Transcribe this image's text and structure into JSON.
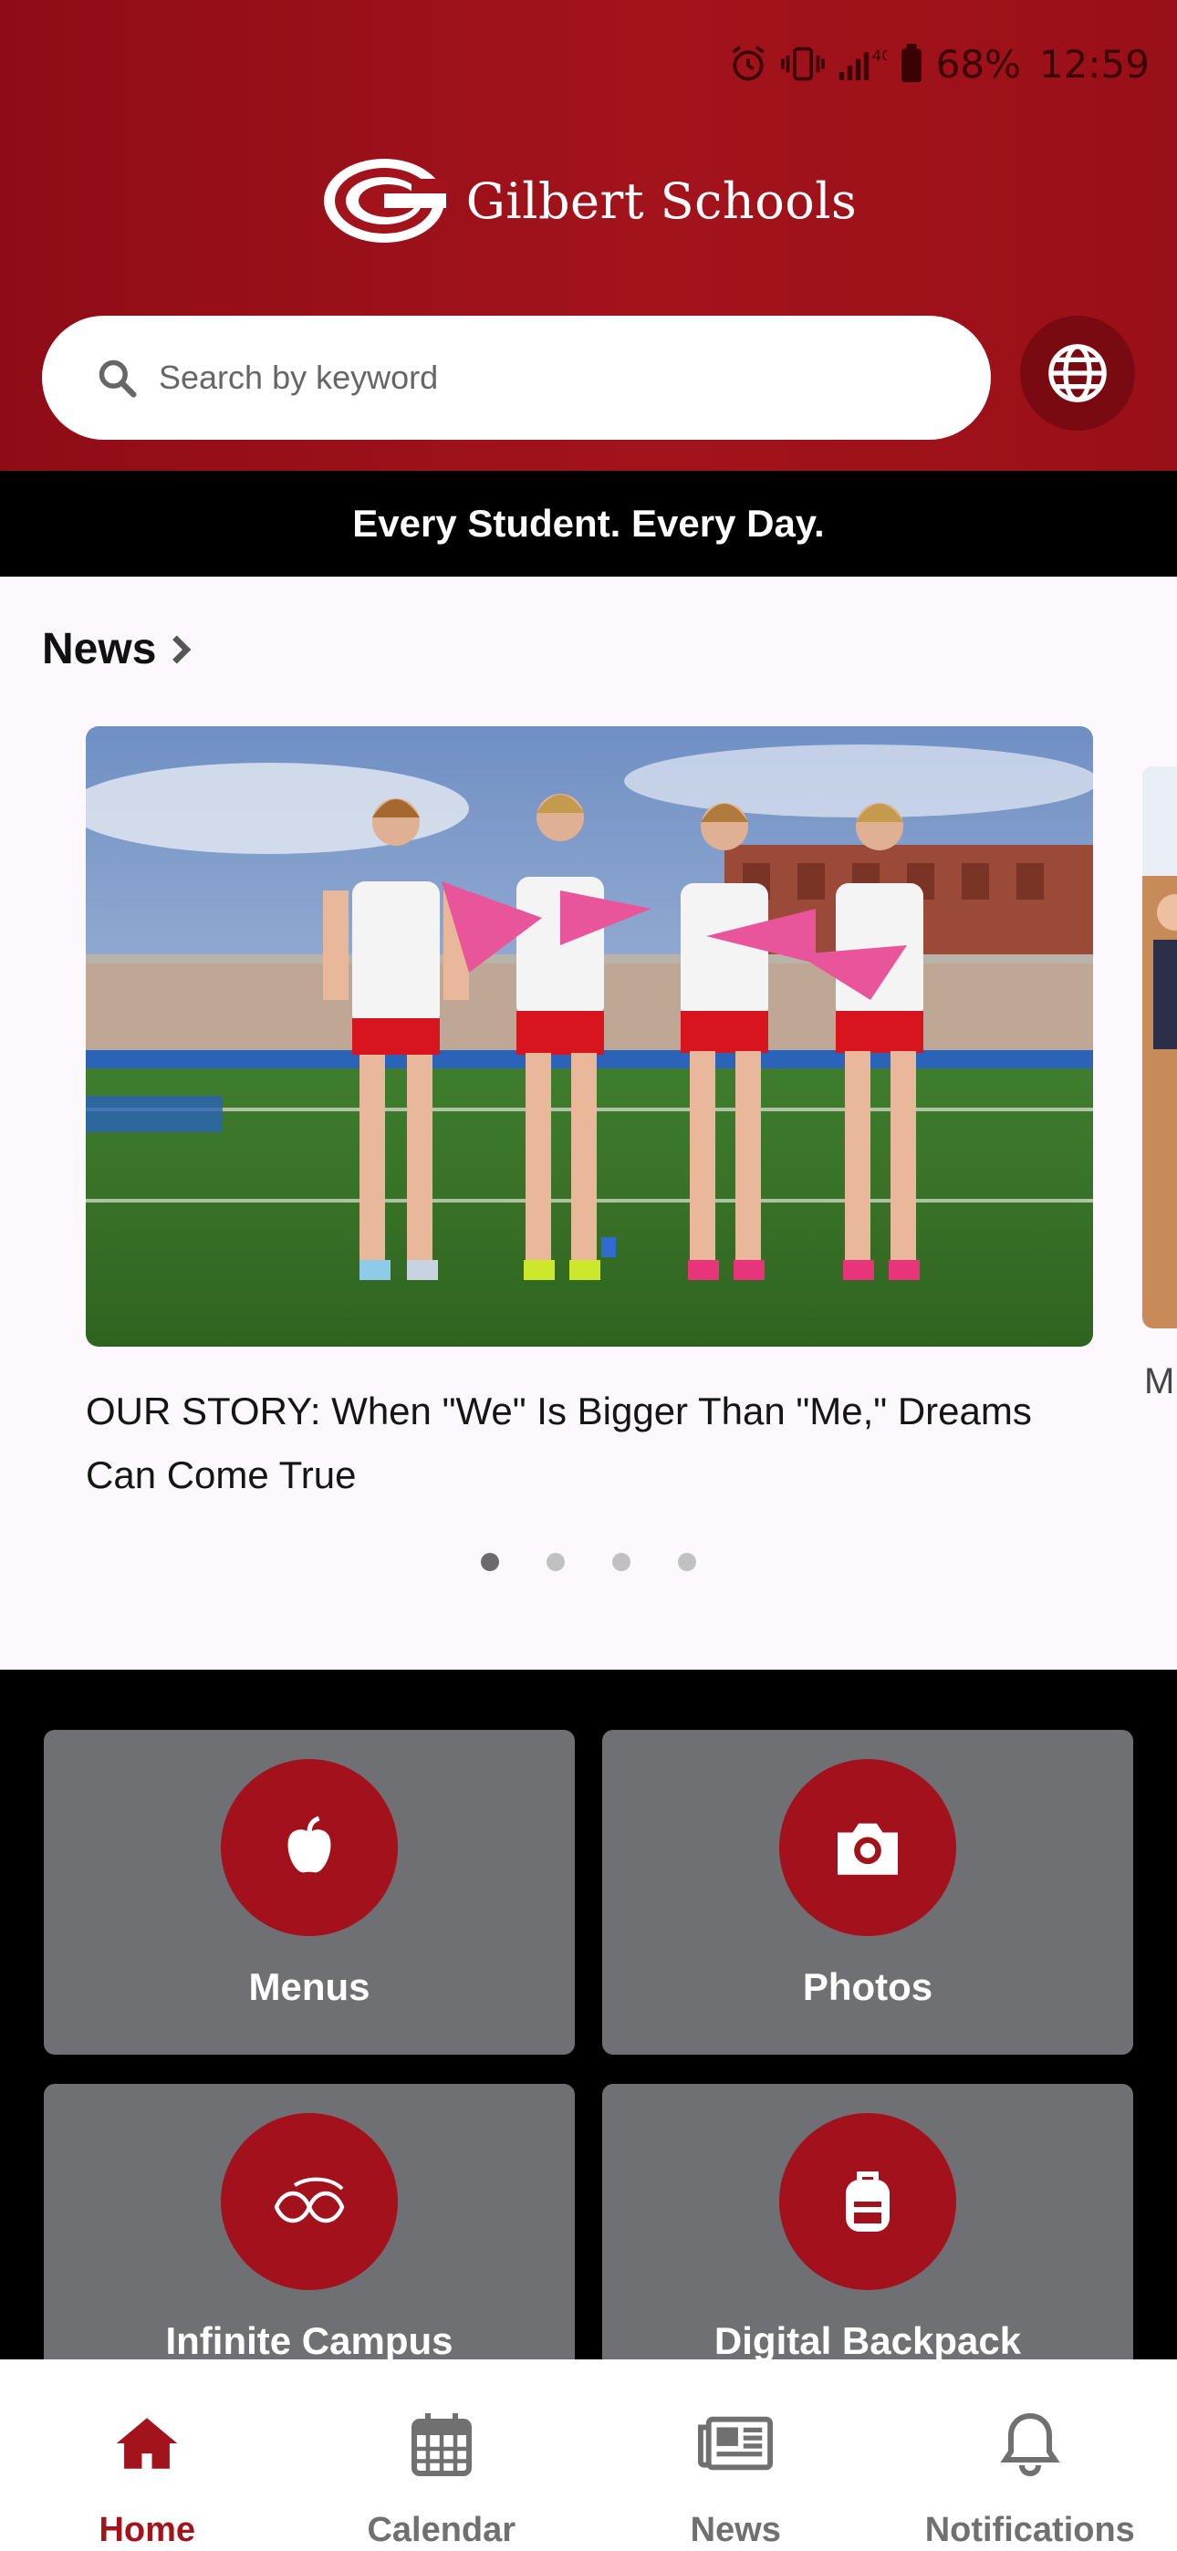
{
  "status_bar": {
    "battery": "68%",
    "time": "12:59",
    "network": "4G"
  },
  "header": {
    "title": "Gilbert Schools",
    "logo_letter": "G"
  },
  "search": {
    "placeholder": "Search by keyword"
  },
  "tagline": "Every Student. Every Day.",
  "news": {
    "section_title": "News",
    "headline": "OUR STORY: When \"We\" Is Bigger Than \"Me,\" Dreams Can Come True",
    "next_card_text": "M",
    "page_count": 4,
    "active_page": 1
  },
  "tiles": [
    {
      "label": "Menus",
      "icon": "apple-icon"
    },
    {
      "label": "Photos",
      "icon": "camera-icon"
    },
    {
      "label": "Infinite Campus",
      "icon": "infinite-campus-icon"
    },
    {
      "label": "Digital Backpack",
      "icon": "backpack-icon"
    }
  ],
  "bottom_nav": [
    {
      "label": "Home",
      "icon": "home-icon",
      "active": true
    },
    {
      "label": "Calendar",
      "icon": "calendar-icon",
      "active": false
    },
    {
      "label": "News",
      "icon": "newspaper-icon",
      "active": false
    },
    {
      "label": "Notifications",
      "icon": "bell-icon",
      "active": false
    }
  ],
  "colors": {
    "brand_red": "#a3131c",
    "tile_gray": "#6f7073",
    "nav_inactive": "#707070"
  }
}
